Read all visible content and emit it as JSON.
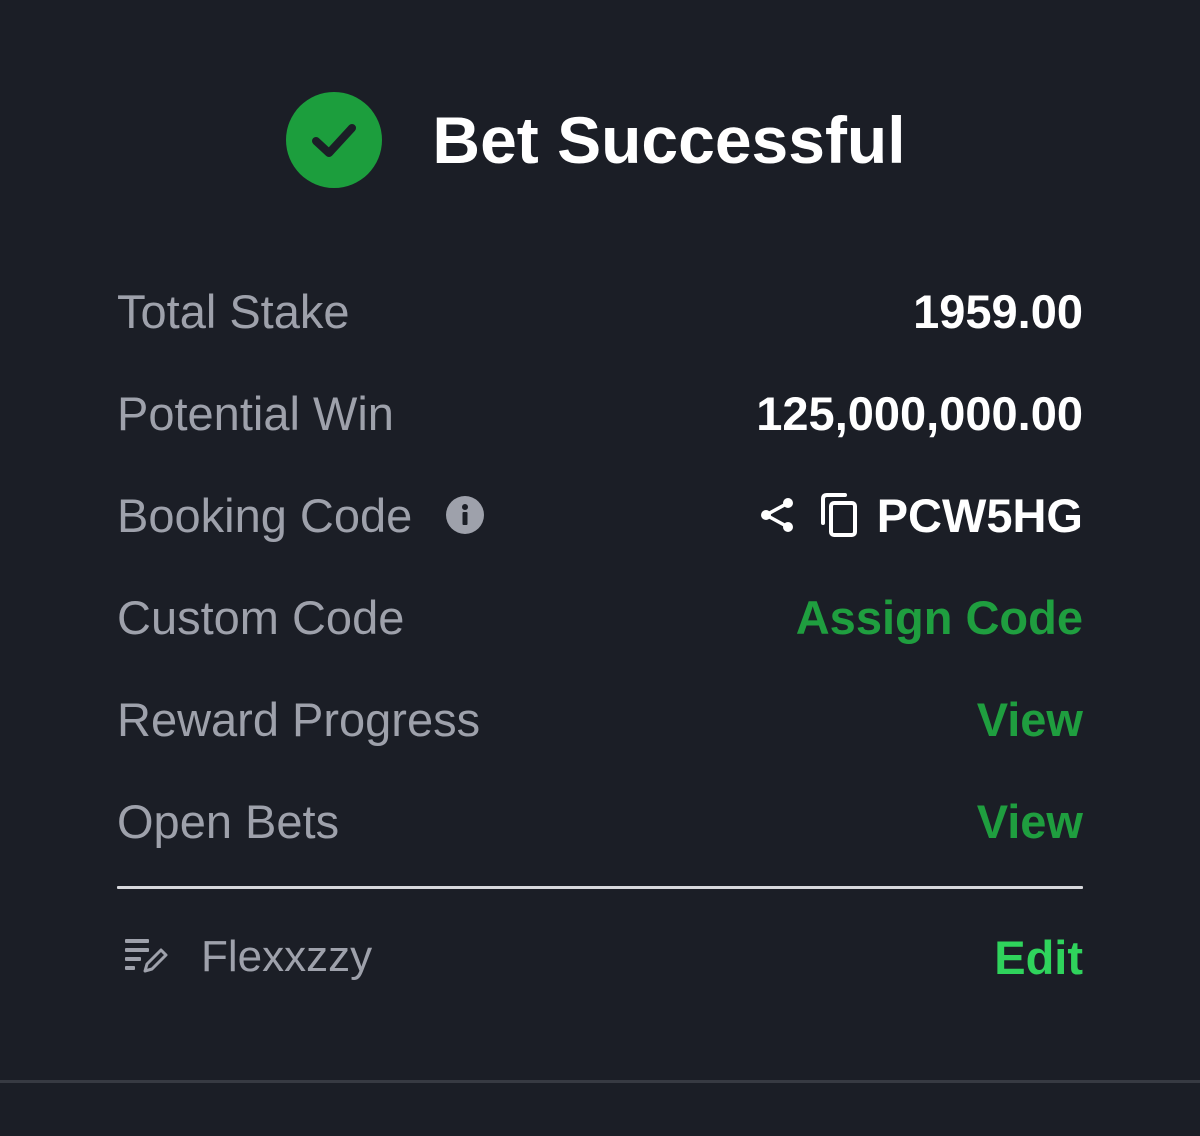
{
  "header": {
    "title": "Bet Successful",
    "icon": "check-circle-icon",
    "icon_color": "#1c9e3d"
  },
  "details": {
    "total_stake_label": "Total Stake",
    "total_stake_value": "1959.00",
    "potential_win_label": "Potential Win",
    "potential_win_value": "125,000,000.00",
    "booking_code_label": "Booking Code",
    "booking_code_value": "PCW5HG",
    "custom_code_label": "Custom Code",
    "custom_code_action": "Assign Code",
    "reward_progress_label": "Reward Progress",
    "reward_progress_action": "View",
    "open_bets_label": "Open Bets",
    "open_bets_action": "View"
  },
  "footer": {
    "username": "Flexxzzy",
    "edit_label": "Edit"
  },
  "colors": {
    "background": "#1b1e26",
    "accent_green": "#1f9e3f",
    "edit_green": "#2fd35c",
    "label_gray": "#9ea1ab"
  }
}
